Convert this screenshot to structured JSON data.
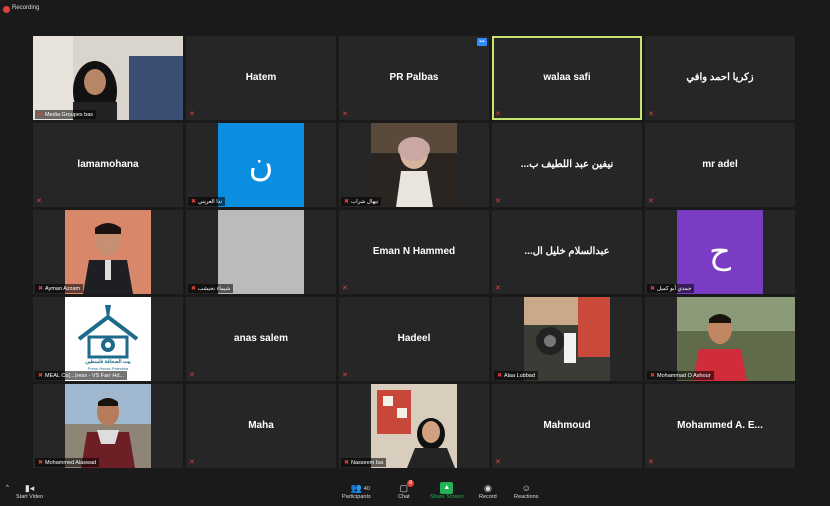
{
  "recording": {
    "label": "Recording"
  },
  "tiles": [
    {
      "name": "Hatem"
    },
    {
      "name": "PR Palbas"
    },
    {
      "name": "walaa safi"
    },
    {
      "name": "زكريا احمد وافي"
    },
    {
      "name": "lamamohana"
    },
    {
      "name": "...نيفين عبد اللطيف ب"
    },
    {
      "name": "mr adel"
    },
    {
      "name": "Eman N Hammed"
    },
    {
      "name": "...عبدالسلام خليل ال"
    },
    {
      "name": "anas salem"
    },
    {
      "name": "Hadeel"
    },
    {
      "name": "Maha"
    },
    {
      "name": "Mahmoud"
    },
    {
      "name": "Mohammed  A.  E..."
    }
  ],
  "captions": {
    "c1": "Media Groupes bas",
    "c2": "ندا العريني",
    "c3": "نيهال شراب",
    "c4": "Ayman Azzam",
    "c5": "شيماء نحيشب",
    "c6": "جمدي أبو كميل",
    "c7": "MEAL Co(...)ress - VS Farr Hd...",
    "c8": "Alaa Lubbad",
    "c9": "Mohammad O Ashour",
    "c10": "Mohammed Alaswad",
    "c11": "Nasseem Isa"
  },
  "avatars": {
    "a1": "ن",
    "a2": "ح"
  },
  "logo": {
    "line1": "بيت الصحافة فلسطين",
    "line2": "Press House-Palestine",
    "colors": {
      "house": "#1e6a8a"
    }
  },
  "toolbar": {
    "start_video": "Start Video",
    "participants": "Participants",
    "participants_count": "40",
    "chat": "Chat",
    "chat_badge": "8",
    "share_screen": "Share Screen",
    "record": "Record",
    "reactions": "Reactions"
  },
  "colors": {
    "active_border": "#c6e46b",
    "share_green": "#23b256",
    "avatar_blue": "#0b8de0",
    "avatar_purple": "#7a3cc4"
  }
}
